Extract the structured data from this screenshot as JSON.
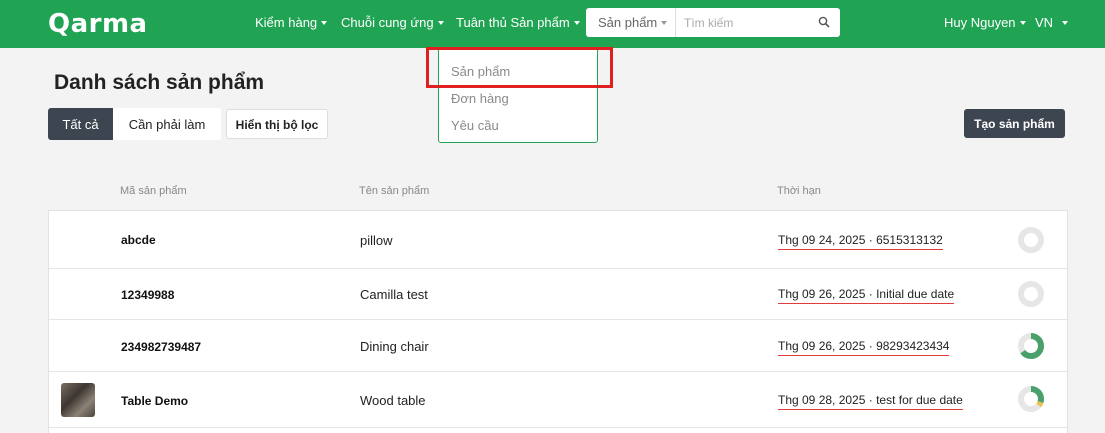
{
  "header": {
    "logo": "Qarma",
    "nav": [
      "Kiểm hàng",
      "Chuỗi cung ứng",
      "Tuân thủ Sản phẩm"
    ],
    "search_type": "Sản phẩm",
    "search_placeholder": "Tìm kiếm",
    "user": "Huy Nguyen",
    "language": "VN"
  },
  "dropdown": {
    "items": [
      "Sản phẩm",
      "Đơn hàng",
      "Yêu cầu"
    ],
    "highlighted": "Sản phẩm"
  },
  "page": {
    "title": "Danh sách sản phẩm",
    "tabs": [
      "Tất cả",
      "Cần phải làm"
    ],
    "active_tab": "Tất cả",
    "filter_button": "Hiển thị bộ lọc",
    "create_button": "Tạo sản phẩm"
  },
  "table": {
    "headers": [
      "Mã sản phẩm",
      "Tên sản phẩm",
      "Thời hạn"
    ],
    "rows": [
      {
        "code": "abcde",
        "name": "pillow",
        "due": "Thg 09 24, 2025 · 6515313132",
        "progress": 0,
        "has_thumb": false
      },
      {
        "code": "12349988",
        "name": "Camilla test",
        "due": "Thg 09 26, 2025 · Initial due date",
        "progress": 0,
        "has_thumb": false
      },
      {
        "code": "234982739487",
        "name": "Dining chair",
        "due": "Thg 09 26, 2025 · 98293423434",
        "progress": 0.65,
        "has_thumb": false
      },
      {
        "code": "Table Demo",
        "name": "Wood table",
        "due": "Thg 09 28, 2025 · test for due date",
        "progress": 0.3,
        "has_thumb": true
      }
    ]
  },
  "colors": {
    "brand": "#21a354",
    "dark": "#3d4650",
    "alert": "#e02020",
    "progress_green": "#4aa06b",
    "progress_yellow": "#f0c24b"
  }
}
